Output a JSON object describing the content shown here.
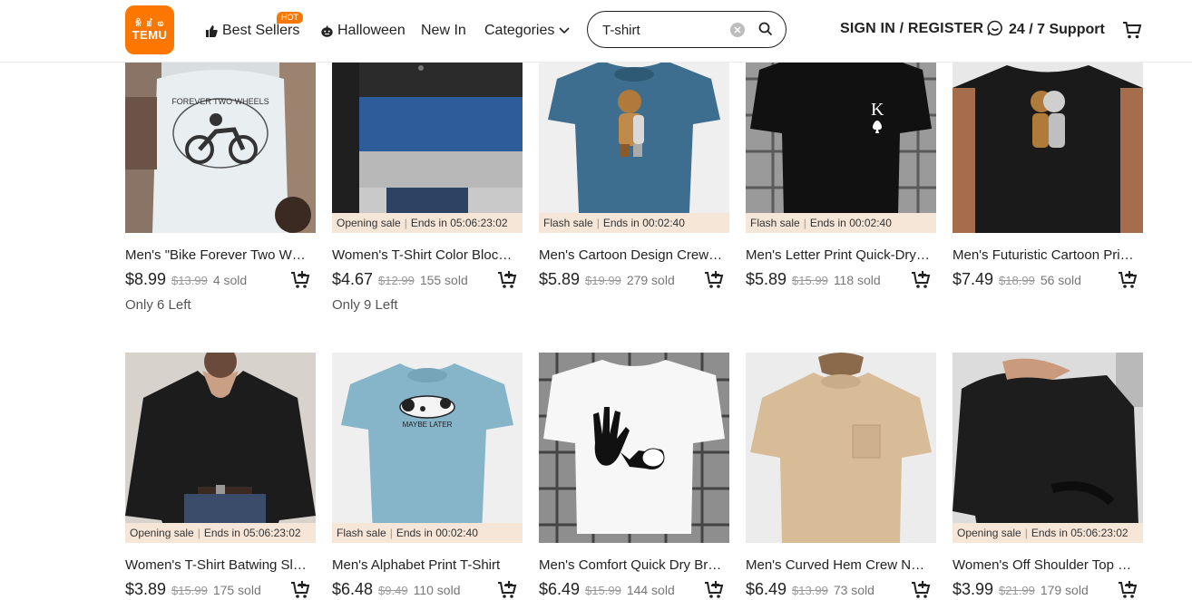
{
  "header": {
    "logo_glyphs": "ꆜ ꀃ ⱷ",
    "logo_text": "TEMU",
    "nav": {
      "best_sellers": "Best Sellers",
      "hot_badge": "HOT",
      "halloween": "Halloween",
      "new_in": "New In",
      "categories": "Categories"
    },
    "search": {
      "value": "T-shirt"
    },
    "sign_in": "SIGN IN / REGISTER",
    "support": "24 / 7 Support"
  },
  "products": [
    {
      "title": "Men's \"Bike Forever Two Wheels\" Print T-Shirt",
      "price": "$8.99",
      "orig": "$13.99",
      "sold": "4 sold",
      "note": "Only 6 Left",
      "sale": null
    },
    {
      "title": "Women's T-Shirt Color Block Long Sleeve",
      "price": "$4.67",
      "orig": "$12.99",
      "sold": "155 sold",
      "note": "Only 9 Left",
      "sale": {
        "label": "Opening sale",
        "ends": "Ends in 05:06:23:02"
      }
    },
    {
      "title": "Men's Cartoon Design Crew Neck T-Shirt",
      "price": "$5.89",
      "orig": "$19.99",
      "sold": "279 sold",
      "note": "",
      "sale": {
        "label": "Flash sale",
        "ends": "Ends in 00:02:40"
      }
    },
    {
      "title": "Men's Letter Print Quick-Dry T-Shirt",
      "price": "$5.89",
      "orig": "$15.99",
      "sold": "118 sold",
      "note": "",
      "sale": {
        "label": "Flash sale",
        "ends": "Ends in 00:02:40"
      }
    },
    {
      "title": "Men's Futuristic Cartoon Print T-Shirt",
      "price": "$7.49",
      "orig": "$18.99",
      "sold": "56 sold",
      "note": "",
      "sale": null
    },
    {
      "title": "Women's T-Shirt Batwing Sleeve Top",
      "price": "$3.89",
      "orig": "$15.99",
      "sold": "175 sold",
      "note": "",
      "sale": {
        "label": "Opening sale",
        "ends": "Ends in 05:06:23:02"
      }
    },
    {
      "title": "Men's Alphabet Print T-Shirt",
      "price": "$6.48",
      "orig": "$9.49",
      "sold": "110 sold",
      "note": "",
      "sale": {
        "label": "Flash sale",
        "ends": "Ends in 00:02:40"
      }
    },
    {
      "title": "Men's Comfort Quick Dry Breathable Tee",
      "price": "$6.49",
      "orig": "$15.99",
      "sold": "144 sold",
      "note": "",
      "sale": null
    },
    {
      "title": "Men's Curved Hem Crew Neck T-Shirt",
      "price": "$6.49",
      "orig": "$13.99",
      "sold": "73 sold",
      "note": "",
      "sale": null
    },
    {
      "title": "Women's Off Shoulder Top Casual",
      "price": "$3.99",
      "orig": "$21.99",
      "sold": "179 sold",
      "note": "",
      "sale": {
        "label": "Opening sale",
        "ends": "Ends in 05:06:23:02"
      }
    }
  ],
  "images": {
    "print_bike": "FOREVER TWO WHEELS",
    "print_k": "K",
    "print_maybe": "MAYBE LATER"
  },
  "colors": {
    "brand": "#fb7701",
    "sale_strip": "#f6e6d8"
  }
}
